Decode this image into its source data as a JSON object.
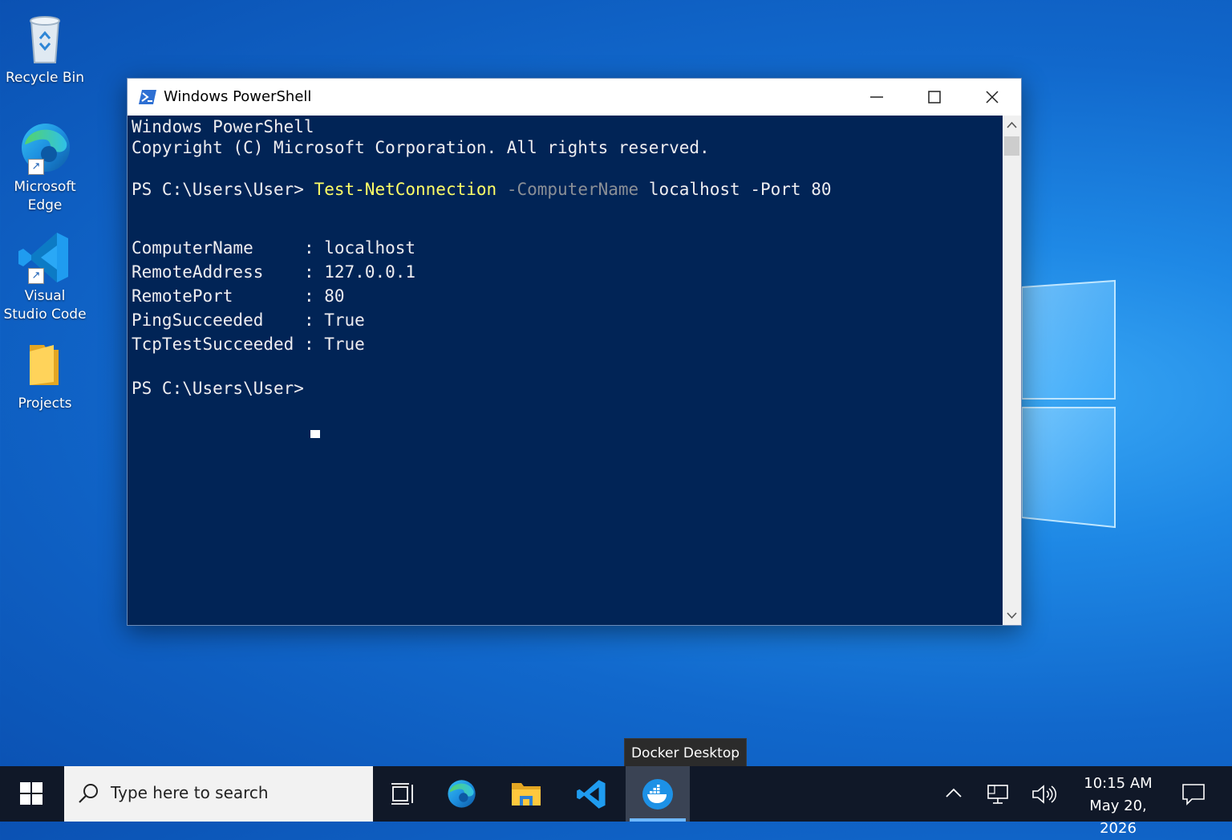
{
  "desktop": {
    "icons": [
      {
        "label": "Recycle Bin"
      },
      {
        "label": "Microsoft Edge"
      },
      {
        "label": "Visual Studio Code"
      },
      {
        "label": "Projects"
      }
    ]
  },
  "window": {
    "title": "Windows PowerShell",
    "console": {
      "header_line1": "Windows PowerShell",
      "header_line2": "Copyright (C) Microsoft Corporation. All rights reserved.",
      "prompt": "PS C:\\Users\\User>",
      "command": "Test-NetConnection",
      "param1": "-ComputerName",
      "arg1": "localhost",
      "param2": "-Port",
      "arg2": "80",
      "results": [
        {
          "key": "ComputerName     ",
          "value": "localhost"
        },
        {
          "key": "RemoteAddress    ",
          "value": "127.0.0.1"
        },
        {
          "key": "RemotePort       ",
          "value": "80"
        },
        {
          "key": "PingSucceeded    ",
          "value": "True"
        },
        {
          "key": "TcpTestSucceeded ",
          "value": "True"
        }
      ],
      "separator": ":",
      "final_prompt": "PS C:\\Users\\User>"
    }
  },
  "tooltip": {
    "text": "Docker Desktop"
  },
  "taskbar": {
    "search_placeholder": "Type here to search",
    "pinned": [
      "task-view-icon",
      "edge-icon",
      "file-explorer-icon",
      "vscode-icon",
      "docker-icon"
    ],
    "active_app": "Docker Desktop",
    "clock_time": "10:15 AM",
    "clock_date": "May 20, 2026"
  },
  "colors": {
    "console_bg": "#012456",
    "command_yellow": "#ffff66",
    "param_gray": "#8a8f96",
    "taskbar_bg": "#101828"
  }
}
